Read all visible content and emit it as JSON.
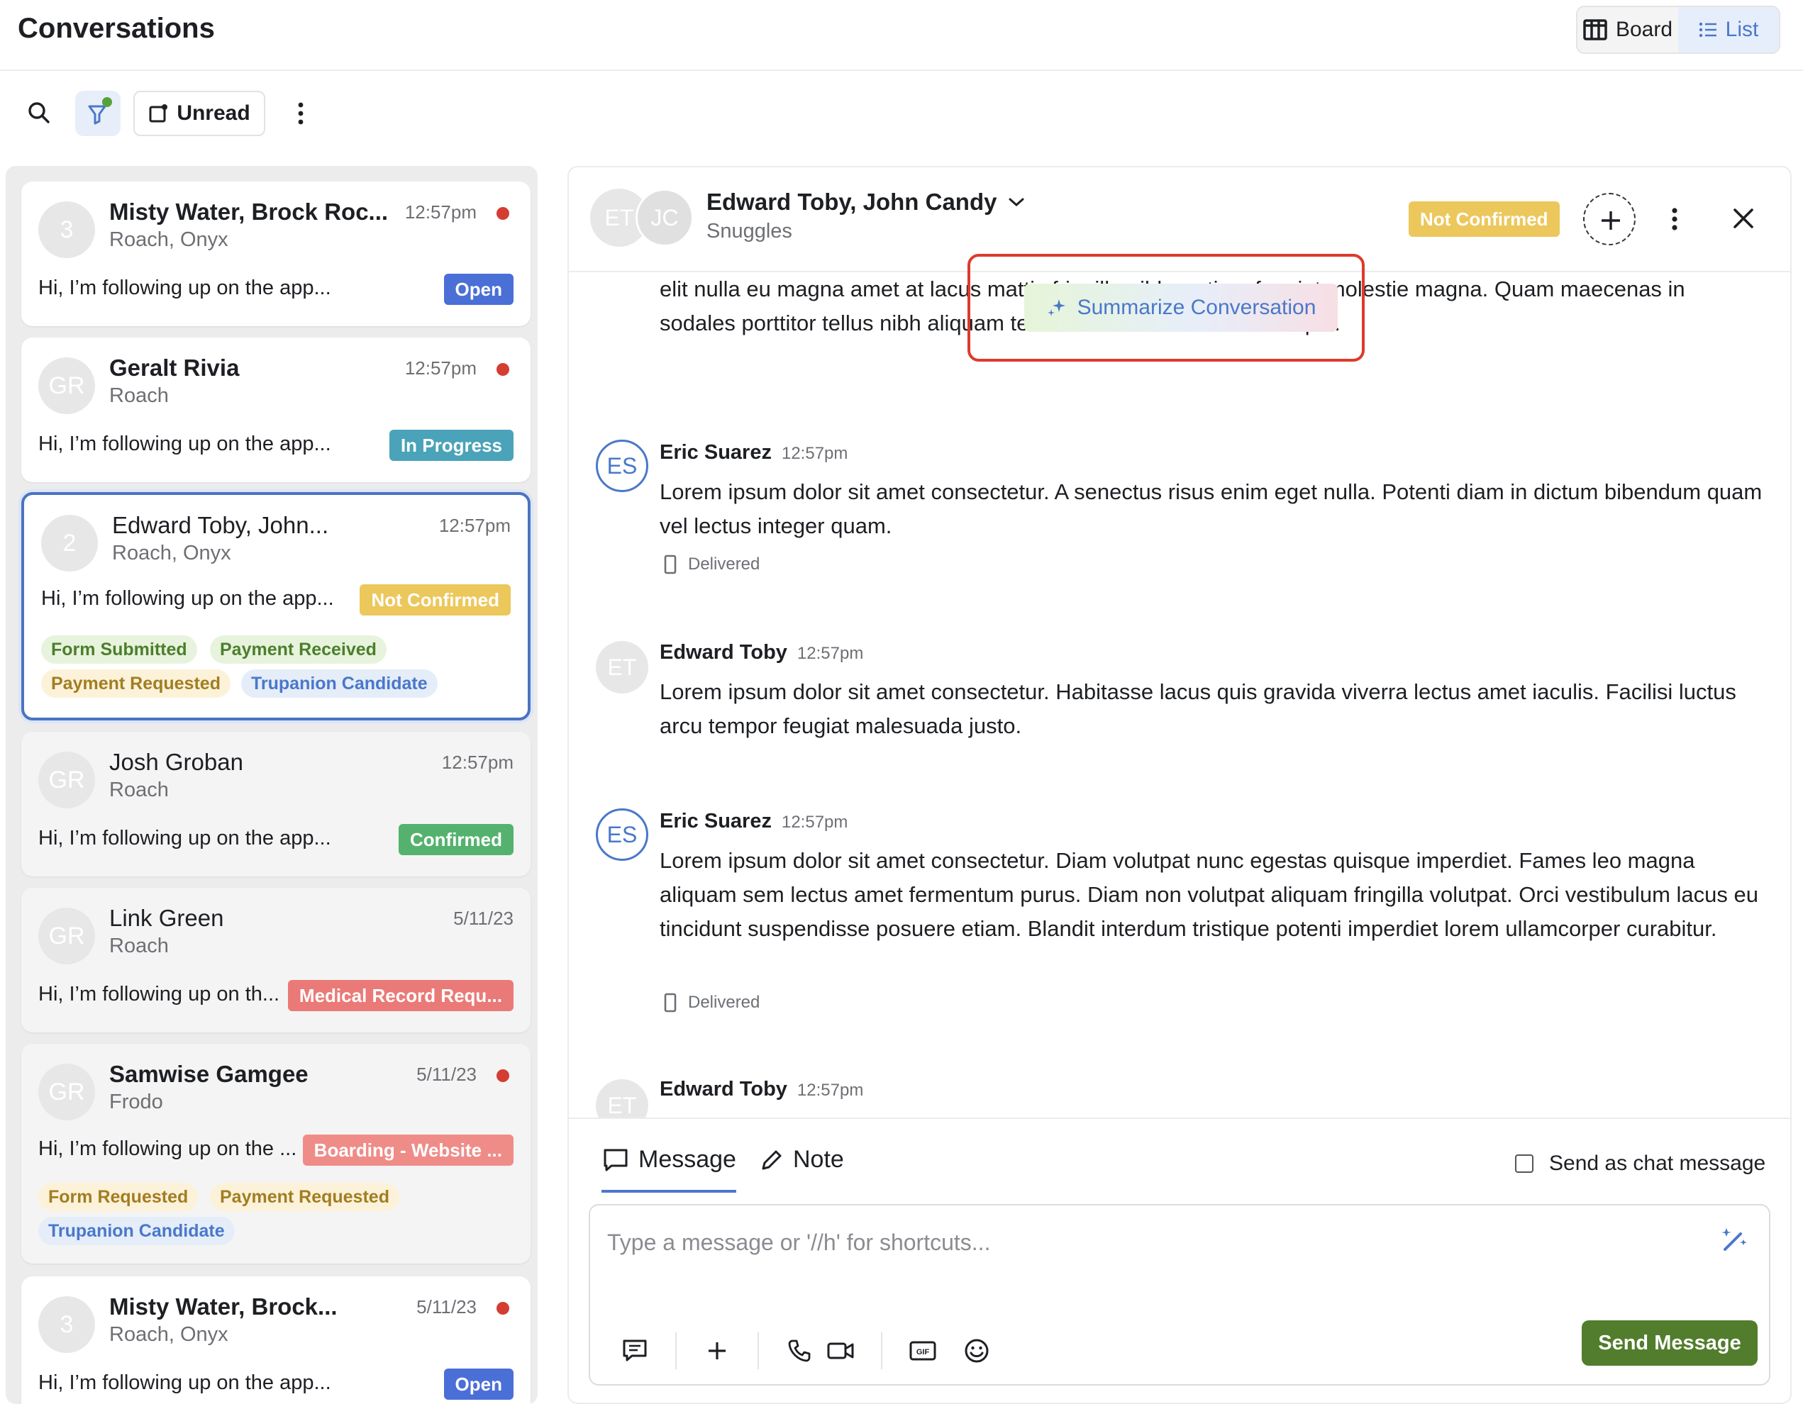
{
  "header": {
    "title": "Conversations",
    "board_label": "Board",
    "list_label": "List"
  },
  "toolbar": {
    "unread_label": "Unread"
  },
  "conversations": [
    {
      "avatar": "3",
      "name": "Misty Water, Brock Roc...",
      "sub": "Roach, Onyx",
      "time": "12:57pm",
      "unread": true,
      "preview": "Hi, I’m following up on the app...",
      "status": "Open",
      "status_color": "#4a6fd6"
    },
    {
      "avatar": "GR",
      "name": "Geralt Rivia",
      "sub": "Roach",
      "time": "12:57pm",
      "unread": true,
      "preview": "Hi, I’m following up on the app...",
      "status": "In Progress",
      "status_color": "#4aa3b8"
    },
    {
      "avatar": "2",
      "name": "Edward Toby, John...",
      "sub": "Roach, Onyx",
      "time": "12:57pm",
      "unread": false,
      "preview": "Hi, I’m following up on the app...",
      "status": "Not Confirmed",
      "status_color": "#ecc75b",
      "tags": [
        "Form Submitted",
        "Payment Received",
        "Payment Requested",
        "Trupanion Candidate"
      ]
    },
    {
      "avatar": "GR",
      "name": "Josh Groban",
      "sub": "Roach",
      "time": "12:57pm",
      "unread": false,
      "preview": "Hi, I’m following up on the app...",
      "status": "Confirmed",
      "status_color": "#55b26e"
    },
    {
      "avatar": "GR",
      "name": "Link Green",
      "sub": "Roach",
      "time": "5/11/23",
      "unread": false,
      "preview": "Hi, I’m following up on th...",
      "status": "Medical Record Requ...",
      "status_color": "#ea7a77"
    },
    {
      "avatar": "GR",
      "name": "Samwise Gamgee",
      "sub": "Frodo",
      "time": "5/11/23",
      "unread": true,
      "preview": "Hi, I’m following up on the ...",
      "status": "Boarding - Website ...",
      "status_color": "#ef8c88",
      "tags": [
        "Form Requested",
        "Payment Requested",
        "Trupanion Candidate"
      ]
    },
    {
      "avatar": "3",
      "name": "Misty Water, Brock...",
      "sub": "Roach, Onyx",
      "time": "5/11/23",
      "unread": true,
      "preview": "Hi, I’m following up on the app...",
      "status": "Open",
      "status_color": "#4a6fd6"
    }
  ],
  "panel": {
    "avatar1": "ET",
    "avatar2": "JC",
    "title": "Edward Toby, John Candy",
    "subtitle": "Snuggles",
    "status": "Not Confirmed"
  },
  "summarize_label": "Summarize Conversation",
  "messages": [
    {
      "text": "elit nulla eu magna amet at lacus mattis fringilla nibh pretium feugiat molestie magna. Quam maecenas in sodales porttitor tellus nibh aliquam tellus. Cursus sit a morbi tristique."
    },
    {
      "avatar": "ES",
      "author": "Eric Suarez",
      "time": "12:57pm",
      "text": "Lorem ipsum dolor sit amet consectetur. A senectus risus enim eget nulla. Potenti diam in dictum bibendum quam vel lectus integer quam.",
      "status": "Delivered"
    },
    {
      "avatar": "ET",
      "author": "Edward Toby",
      "time": "12:57pm",
      "text": "Lorem ipsum dolor sit amet consectetur. Habitasse lacus quis gravida viverra lectus amet iaculis. Facilisi luctus arcu tempor feugiat malesuada justo."
    },
    {
      "avatar": "ES",
      "author": "Eric Suarez",
      "time": "12:57pm",
      "text": "Lorem ipsum dolor sit amet consectetur. Diam volutpat nunc egestas quisque imperdiet. Fames leo magna aliquam sem lectus amet fermentum purus. Diam non volutpat aliquam fringilla volutpat. Orci vestibulum lacus eu tincidunt suspendisse posuere etiam. Blandit interdum tristique potenti imperdiet lorem ullamcorper curabitur.",
      "status": "Delivered"
    },
    {
      "avatar": "ET",
      "author": "Edward Toby",
      "time": "12:57pm"
    }
  ],
  "composer": {
    "tab_message": "Message",
    "tab_note": "Note",
    "chat_checkbox_label": "Send as chat message",
    "placeholder": "Type a message or '//h' for shortcuts...",
    "send_label": "Send Message"
  },
  "colors": {
    "accent": "#4a78c9",
    "send": "#517d2c",
    "unread_dot": "#d43d32",
    "highlight": "#dd3a2c"
  }
}
